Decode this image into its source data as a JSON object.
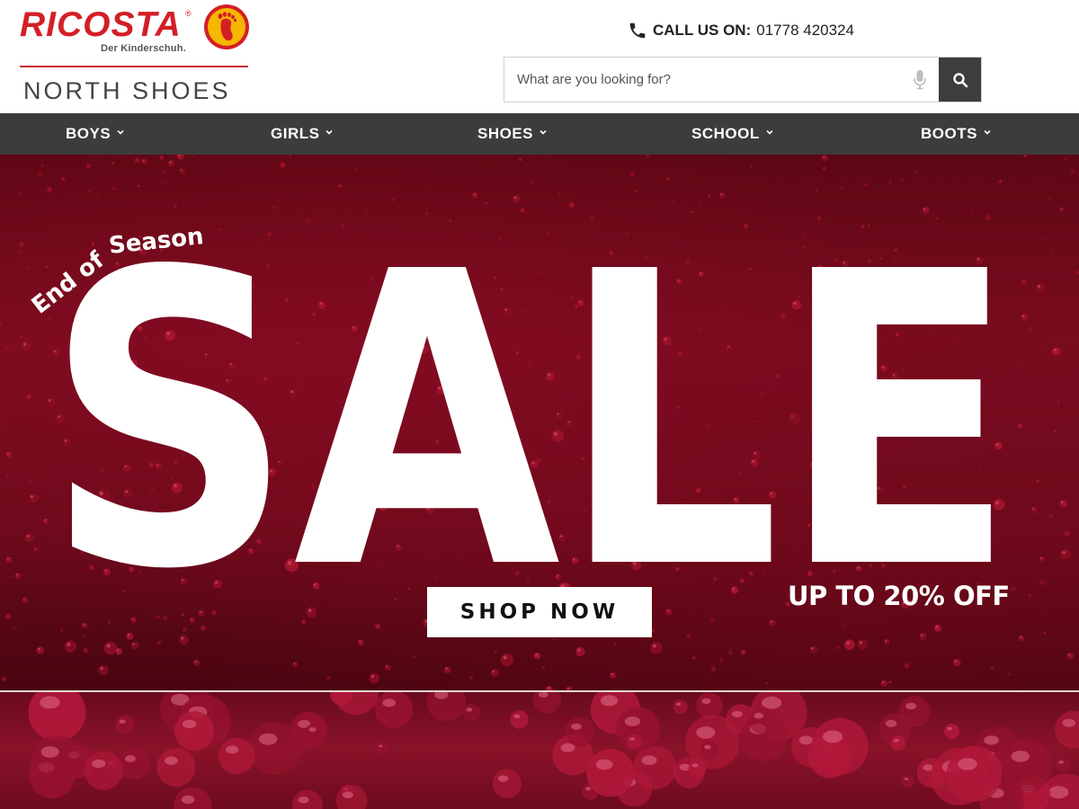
{
  "brand": {
    "logo_text": "RICOSTA",
    "logo_tagline": "Der Kinderschuh.",
    "store_name": "NORTH SHOES"
  },
  "contact": {
    "label": "CALL US ON:",
    "phone": "01778 420324"
  },
  "search": {
    "placeholder": "What are you looking for?",
    "value": ""
  },
  "nav": {
    "items": [
      {
        "label": "BOYS"
      },
      {
        "label": "GIRLS"
      },
      {
        "label": "SHOES"
      },
      {
        "label": "SCHOOL"
      },
      {
        "label": "BOOTS"
      }
    ]
  },
  "hero": {
    "kicker": "End of Season",
    "headline": "SALE",
    "cta_label": "SHOP NOW",
    "discount_text": "UP TO 20% OFF"
  },
  "colors": {
    "brand_red": "#d31f26",
    "nav_bg": "#3b3c3b",
    "hero_red": "#7a0c1f",
    "logo_yellow": "#f6b700"
  },
  "icons": {
    "phone": "phone-icon",
    "mic": "microphone-icon",
    "search": "search-icon",
    "chevron": "chevron-down-icon",
    "logo": "footprint-logo-icon"
  }
}
